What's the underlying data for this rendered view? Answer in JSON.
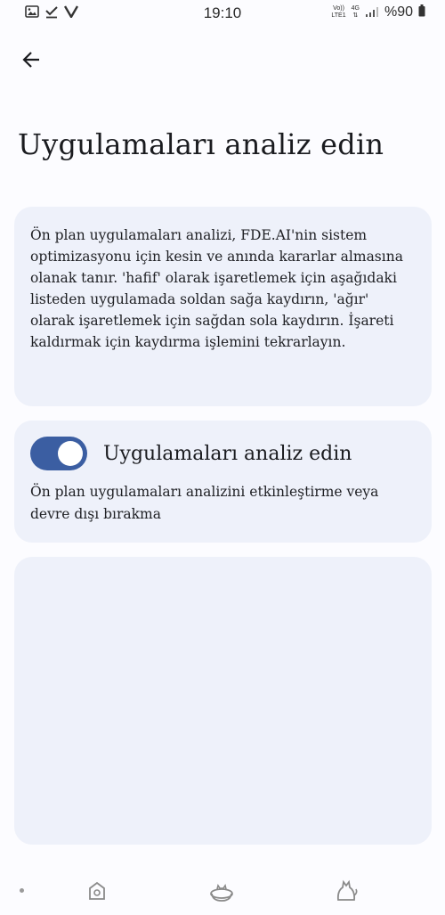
{
  "status_bar": {
    "time": "19:10",
    "left_icons": [
      "image-icon",
      "download-check-icon",
      "v-icon"
    ],
    "network_label_top": "Vo))",
    "network_label_bottom": "LTE1",
    "network_type": "4G",
    "battery": "%90"
  },
  "header": {
    "back_icon": "arrow-left-icon",
    "title": "Uygulamaları analiz edin"
  },
  "info_card": {
    "text": "Ön plan uygulamaları analizi, FDE.AI'nin sistem optimizasyonu için kesin ve anında kararlar almasına olanak tanır. 'hafif' olarak işaretlemek için aşağıdaki listeden uygulamada soldan sağa kaydırın, 'ağır' olarak işaretlemek için sağdan sola kaydırın. İşareti kaldırmak için kaydırma işlemini tekrarlayın."
  },
  "toggle_card": {
    "enabled": true,
    "title": "Uygulamaları analiz edin",
    "description": "Ön plan uygulamaları analizini etkinleştirme veya devre dışı bırakma"
  },
  "app_list": {
    "items": []
  },
  "bottom_nav": {
    "icons": [
      "home-icon",
      "cat-bowl-icon",
      "cat-icon"
    ]
  },
  "colors": {
    "background": "#fcfcff",
    "card": "#eef1fa",
    "switch_on": "#3b5ea2"
  }
}
